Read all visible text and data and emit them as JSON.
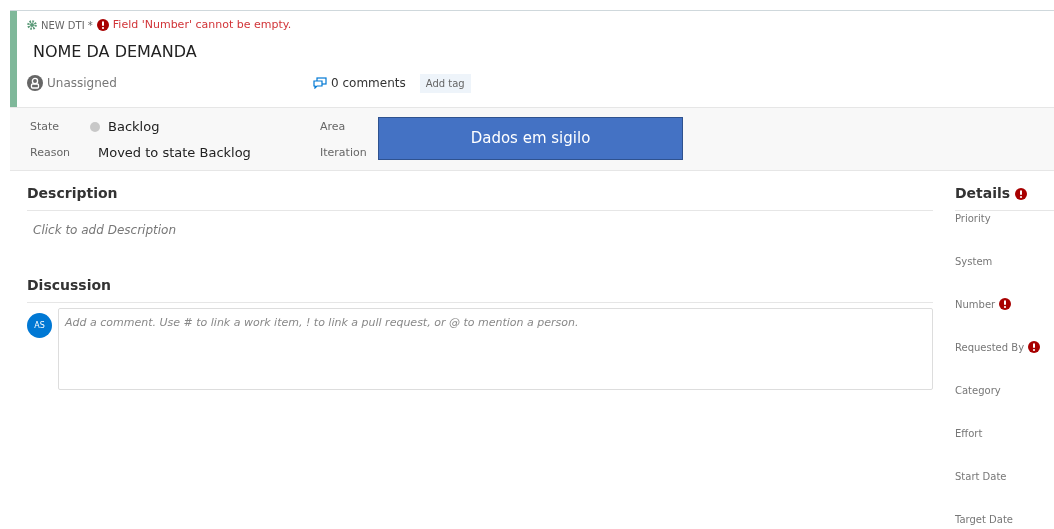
{
  "header": {
    "type_label": "NEW DTI *",
    "error": "Field 'Number' cannot be empty.",
    "title": "NOME DA DEMANDA",
    "assignee": "Unassigned",
    "comments": "0 comments",
    "add_tag": "Add tag"
  },
  "fields": [
    {
      "label": "State",
      "value": "Backlog",
      "kind": "state"
    },
    {
      "label": "Reason",
      "value": "Moved to state Backlog",
      "kind": "text"
    },
    {
      "label": "Area",
      "kind": "hidden"
    },
    {
      "label": "Iteration",
      "kind": "hidden"
    }
  ],
  "redaction": "Dados em sigilo",
  "description": {
    "heading": "Description",
    "placeholder": "Click to add Description"
  },
  "discussion": {
    "heading": "Discussion",
    "avatar": "AS",
    "placeholder": "Add a comment. Use # to link a work item, ! to link a pull request, or @ to mention a person."
  },
  "details": {
    "heading": "Details",
    "error": true,
    "fields": [
      {
        "label": "Priority",
        "required": false
      },
      {
        "label": "System",
        "required": false
      },
      {
        "label": "Number",
        "required": true
      },
      {
        "label": "Requested By",
        "required": true
      },
      {
        "label": "Category",
        "required": false
      },
      {
        "label": "Effort",
        "required": false
      },
      {
        "label": "Start Date",
        "required": false
      },
      {
        "label": "Target Date",
        "required": false
      }
    ]
  }
}
